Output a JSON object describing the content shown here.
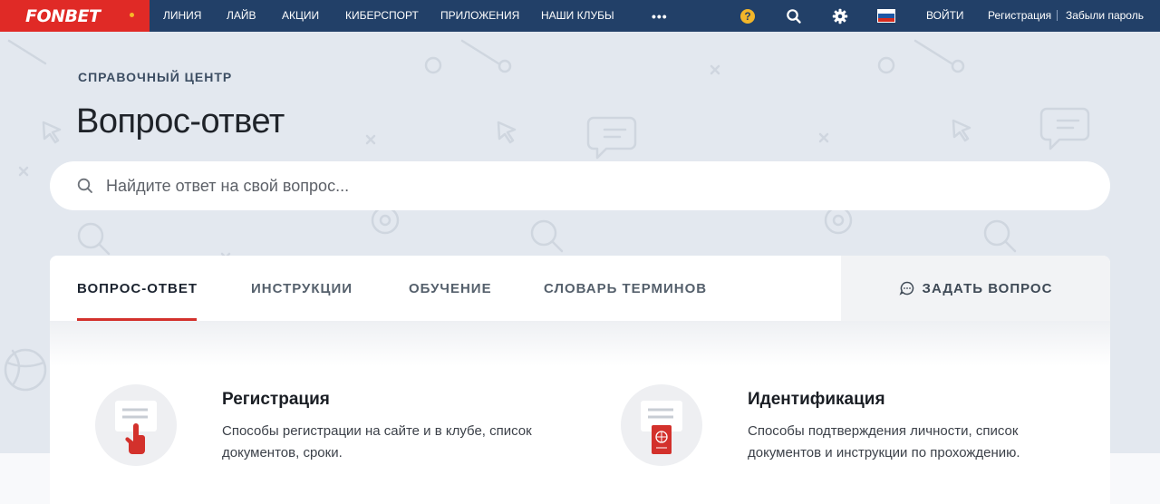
{
  "nav": {
    "logo": "FONBET",
    "items": [
      "ЛИНИЯ",
      "ЛАЙВ",
      "АКЦИИ",
      "КИБЕРСПОРТ",
      "ПРИЛОЖЕНИЯ",
      "НАШИ КЛУБЫ"
    ],
    "more": "•••",
    "help": "?",
    "login": "ВОЙТИ",
    "register": "Регистрация",
    "forgot": "Забыли пароль"
  },
  "hero": {
    "breadcrumb": "СПРАВОЧНЫЙ ЦЕНТР",
    "title": "Вопрос-ответ",
    "search_placeholder": "Найдите ответ на свой вопрос..."
  },
  "tabs": [
    "ВОПРОС-ОТВЕТ",
    "ИНСТРУКЦИИ",
    "ОБУЧЕНИЕ",
    "СЛОВАРЬ ТЕРМИНОВ"
  ],
  "active_tab": "ВОПРОС-ОТВЕТ",
  "ask_button": "ЗАДАТЬ ВОПРОС",
  "categories": [
    {
      "title": "Регистрация",
      "text": "Способы регистрации на сайте и в клубе, список документов, сроки.",
      "icon": "hand-pointer-icon"
    },
    {
      "title": "Идентификация",
      "text": "Способы подтверждения личности, список документов и инструкции по прохождению.",
      "icon": "passport-icon"
    }
  ],
  "colors": {
    "brand_red": "#e02a26",
    "nav_bg": "#224068",
    "hero_bg": "#e3e8ef",
    "accent_yellow": "#f2b62a"
  }
}
